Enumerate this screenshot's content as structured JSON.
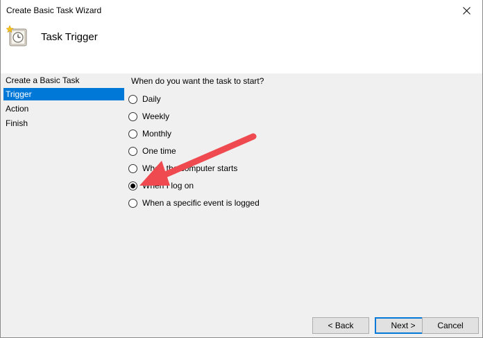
{
  "window": {
    "title": "Create Basic Task Wizard"
  },
  "header": {
    "title": "Task Trigger",
    "icon": "task-scheduler-clock-icon"
  },
  "nav": {
    "items": [
      {
        "label": "Create a Basic Task",
        "selected": false
      },
      {
        "label": "Trigger",
        "selected": true
      },
      {
        "label": "Action",
        "selected": false
      },
      {
        "label": "Finish",
        "selected": false
      }
    ]
  },
  "content": {
    "question": "When do you want the task to start?",
    "options": [
      {
        "label": "Daily",
        "checked": false
      },
      {
        "label": "Weekly",
        "checked": false
      },
      {
        "label": "Monthly",
        "checked": false
      },
      {
        "label": "One time",
        "checked": false
      },
      {
        "label": "When the computer starts",
        "checked": false
      },
      {
        "label": "When I log on",
        "checked": true
      },
      {
        "label": "When a specific event is logged",
        "checked": false
      }
    ]
  },
  "buttons": {
    "back": "< Back",
    "next": "Next >",
    "cancel": "Cancel"
  },
  "annotation": {
    "arrow_color": "#ef4a4f"
  },
  "colors": {
    "selection": "#0078d7",
    "panel": "#f0f0f0"
  }
}
